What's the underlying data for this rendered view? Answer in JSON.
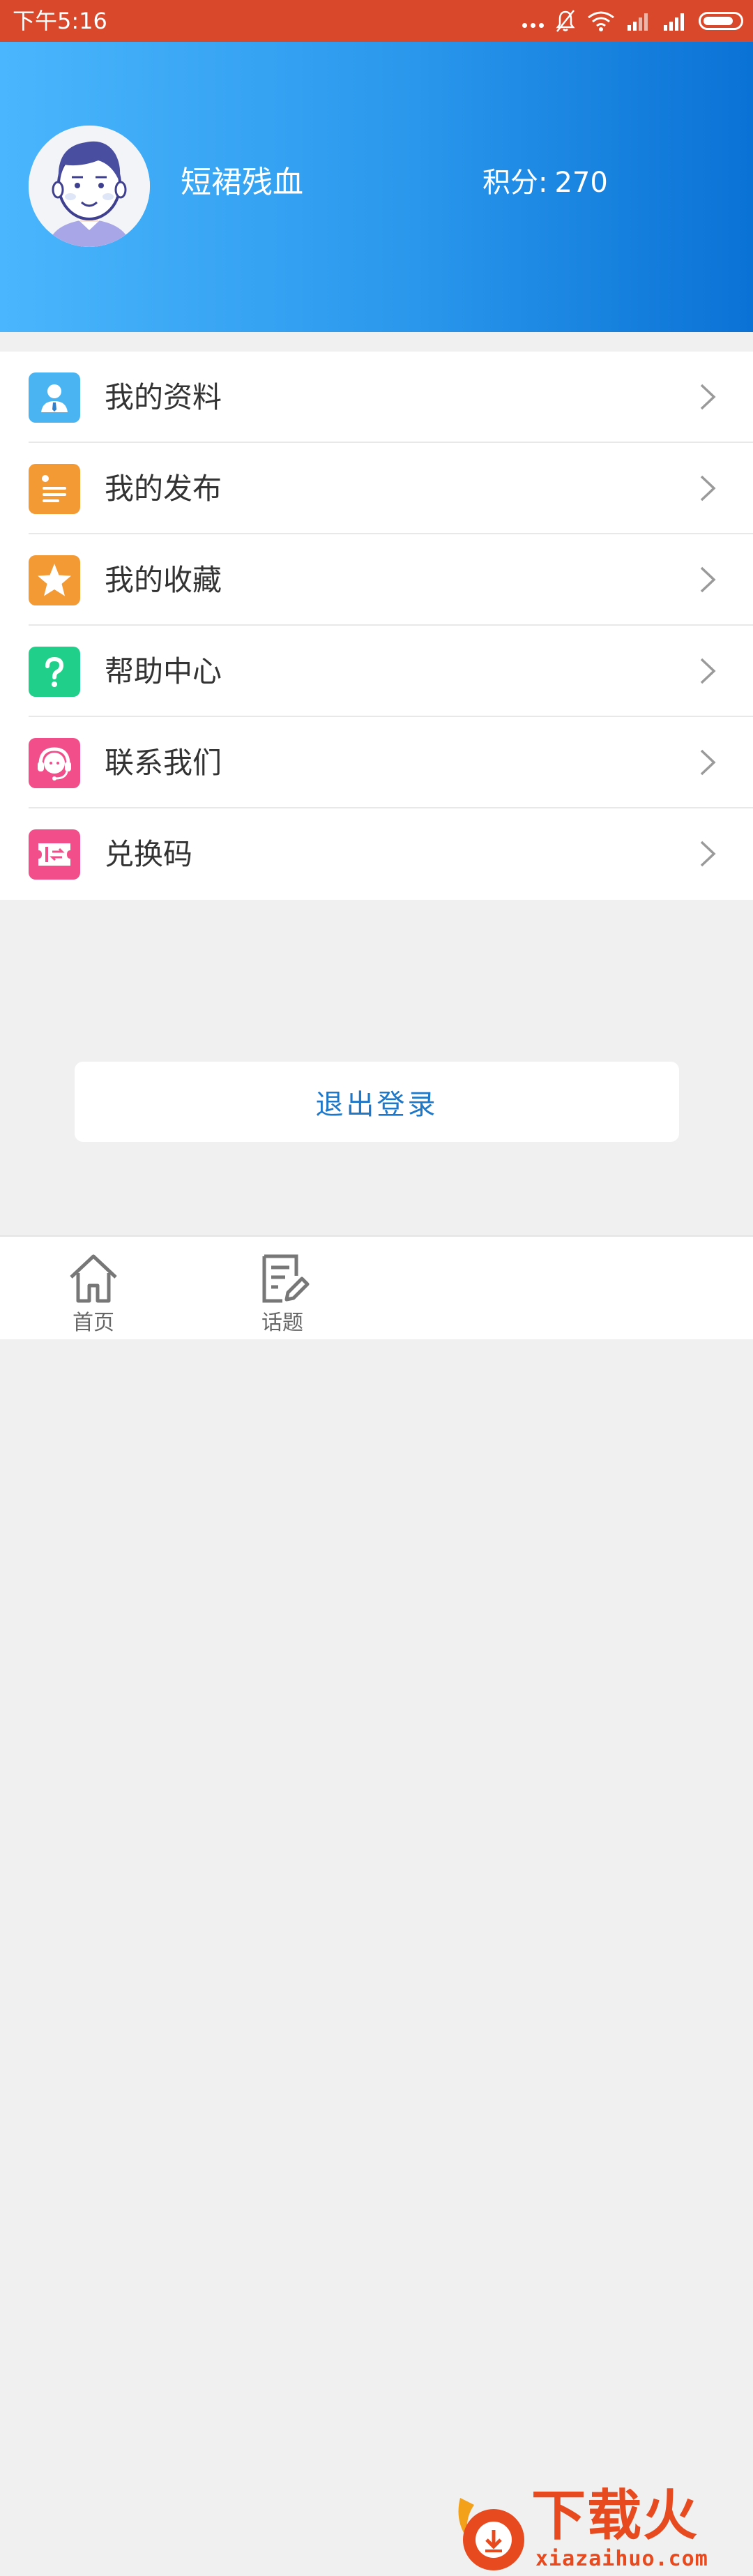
{
  "status_bar": {
    "time": "下午5:16",
    "icons": [
      "more-dots-icon",
      "mute-bell-icon",
      "wifi-icon",
      "signal-icon",
      "signal-icon",
      "battery-icon"
    ]
  },
  "profile": {
    "username": "短裙残血",
    "points_label": "积分:",
    "points_value": "270",
    "avatar": "user-avatar"
  },
  "menu": {
    "items": [
      {
        "label": "我的资料",
        "icon": "profile-icon",
        "color": "#4ab4f3"
      },
      {
        "label": "我的发布",
        "icon": "document-list-icon",
        "color": "#f39a35"
      },
      {
        "label": "我的收藏",
        "icon": "star-icon",
        "color": "#f39a35"
      },
      {
        "label": "帮助中心",
        "icon": "help-question-icon",
        "color": "#20d08a"
      },
      {
        "label": "联系我们",
        "icon": "customer-service-icon",
        "color": "#f24f8a"
      },
      {
        "label": "兑换码",
        "icon": "ticket-icon",
        "color": "#f24f8a"
      }
    ]
  },
  "logout": {
    "label": "退出登录"
  },
  "bottom_nav": {
    "tabs": [
      {
        "label": "首页",
        "icon": "home-icon"
      },
      {
        "label": "话题",
        "icon": "topic-edit-icon"
      }
    ]
  },
  "watermark": {
    "text": "下载火",
    "url": "xiazaihuo.com"
  },
  "colors": {
    "status_bar": "#d9482a",
    "header_gradient_start": "#4ab6fd",
    "header_gradient_end": "#0a72d5",
    "logout_text": "#1f77c8"
  }
}
